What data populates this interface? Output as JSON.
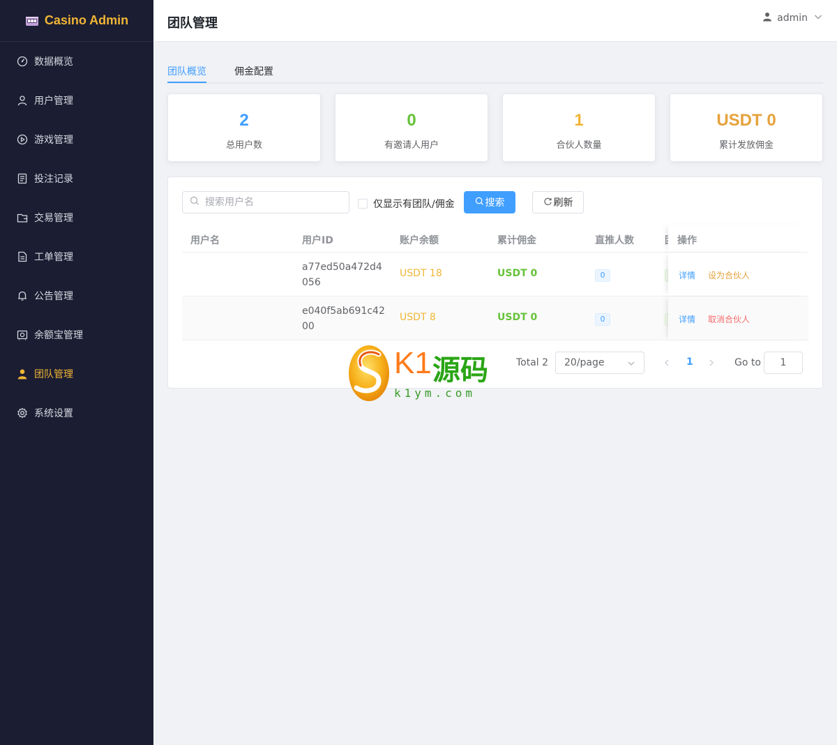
{
  "brand": {
    "title": "Casino Admin",
    "icon": "slot-machine-icon",
    "color": "#f0b535"
  },
  "sidebar": {
    "items": [
      {
        "label": "数据概览",
        "icon": "dashboard-icon",
        "active": false
      },
      {
        "label": "用户管理",
        "icon": "user-icon",
        "active": false
      },
      {
        "label": "游戏管理",
        "icon": "play-icon",
        "active": false
      },
      {
        "label": "投注记录",
        "icon": "document-icon",
        "active": false
      },
      {
        "label": "交易管理",
        "icon": "wallet-icon",
        "active": false
      },
      {
        "label": "工单管理",
        "icon": "ticket-icon",
        "active": false
      },
      {
        "label": "公告管理",
        "icon": "bell-icon",
        "active": false
      },
      {
        "label": "余额宝管理",
        "icon": "safe-icon",
        "active": false
      },
      {
        "label": "团队管理",
        "icon": "user-filled-icon",
        "active": true
      },
      {
        "label": "系统设置",
        "icon": "gear-icon",
        "active": false
      }
    ]
  },
  "header": {
    "title": "团队管理",
    "username": "admin"
  },
  "tabs": [
    {
      "label": "团队概览",
      "active": true
    },
    {
      "label": "佣金配置",
      "active": false
    }
  ],
  "stats": [
    {
      "value": "2",
      "label": "总用户数",
      "color": "#409eff"
    },
    {
      "value": "0",
      "label": "有邀请人用户",
      "color": "#67c23a"
    },
    {
      "value": "1",
      "label": "合伙人数量",
      "color": "#f0b535"
    },
    {
      "value": "USDT 0",
      "label": "累计发放佣金",
      "color": "#e6a23c"
    }
  ],
  "filters": {
    "search_placeholder": "搜索用户名",
    "search_value": "",
    "checkbox_label": "仅显示有团队/佣金",
    "checkbox_checked": false,
    "search_button": "搜索",
    "refresh_button": "刷新"
  },
  "table": {
    "columns": [
      "用户名",
      "用户ID",
      "账户余额",
      "累计佣金",
      "直推人数",
      "团",
      "操作"
    ],
    "rows": [
      {
        "username": "",
        "id": "a77ed50a472d4056",
        "balance": "USDT 18",
        "commission": "USDT 0",
        "direct": "0",
        "detail": "详情",
        "action": "设为合伙人",
        "action_type": "set"
      },
      {
        "username": "",
        "id": "e040f5ab691c4200",
        "balance": "USDT 8",
        "commission": "USDT 0",
        "direct": "0",
        "detail": "详情",
        "action": "取消合伙人",
        "action_type": "cancel"
      }
    ]
  },
  "pagination": {
    "total": "Total 2",
    "page_size": "20/page",
    "current_page": "1",
    "goto_label": "Go to",
    "goto_value": "1"
  },
  "watermark": {
    "brand_k1": "K1",
    "brand_ym": "源码",
    "url": "k1ym.com"
  }
}
